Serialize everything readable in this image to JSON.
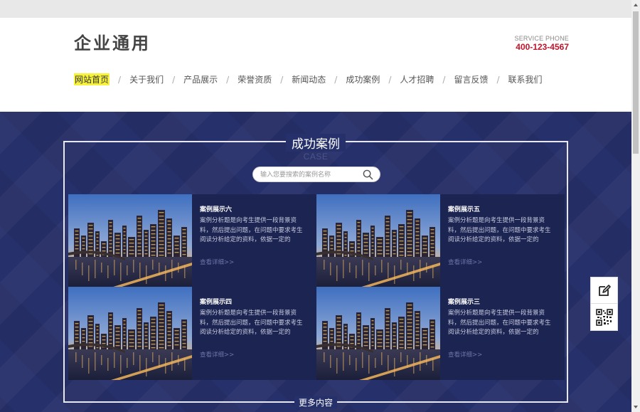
{
  "header": {
    "logo": "企业通用",
    "service_label": "SERVICE PHONE",
    "phone": "400-123-4567"
  },
  "nav": {
    "items": [
      "网站首页",
      "关于我们",
      "产品展示",
      "荣誉资质",
      "新闻动态",
      "成功案例",
      "人才招聘",
      "留言反馈",
      "联系我们"
    ],
    "active_index": 0,
    "separator": "/"
  },
  "section": {
    "title": "成功案例",
    "subtitle": "CASE",
    "search_placeholder": "输入您要搜索的案例名称",
    "more_label": "更多内容"
  },
  "cases": [
    {
      "title": "案例展示六",
      "desc": "案例分析题是向考生提供一段背景资料，然后提出问题，在问题中要求考生阅读分析给定的资料，依据一定的",
      "more": "查看详细>>"
    },
    {
      "title": "案例展示五",
      "desc": "案例分析题是向考生提供一段背景资料，然后提出问题，在问题中要求考生阅读分析给定的资料，依据一定的",
      "more": "查看详细>>"
    },
    {
      "title": "案例展示四",
      "desc": "案例分析题是向考生提供一段背景资料，然后提出问题，在问题中要求考生阅读分析给定的资料，依据一定的",
      "more": "查看详细>>"
    },
    {
      "title": "案例展示三",
      "desc": "案例分析题是向考生提供一段背景资料，然后提出问题，在问题中要求考生阅读分析给定的资料，依据一定的",
      "more": "查看详细>>"
    }
  ],
  "floating": {
    "icons": [
      "edit-icon",
      "qr-code-icon"
    ]
  },
  "colors": {
    "main_bg": "#26306a",
    "card_bg": "#1c2451",
    "phone": "#c0142a",
    "active_nav_highlight": "#f7f23a"
  }
}
